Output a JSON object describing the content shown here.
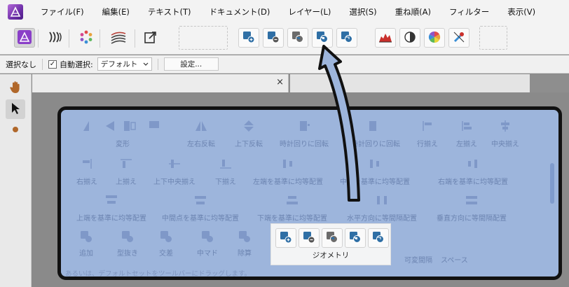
{
  "menu": [
    "ファイル(F)",
    "編集(E)",
    "テキスト(T)",
    "ドキュメント(D)",
    "レイヤー(L)",
    "選択(S)",
    "重ね順(A)",
    "フィルター",
    "表示(V)"
  ],
  "toolbar": {
    "personas": [
      {
        "icon": "designer-persona-icon"
      },
      {
        "icon": "pixel-persona-icon"
      },
      {
        "icon": "photo-persona-icon"
      },
      {
        "icon": "vector-brush-icon"
      },
      {
        "icon": "export-persona-icon"
      }
    ],
    "geometry": [
      {
        "icon": "geometry-add-icon"
      },
      {
        "icon": "geometry-subtract-icon"
      },
      {
        "icon": "geometry-intersect-icon"
      },
      {
        "icon": "geometry-xor-icon"
      },
      {
        "icon": "geometry-divide-icon"
      }
    ],
    "adjust": [
      {
        "icon": "levels-icon"
      },
      {
        "icon": "contrast-icon"
      },
      {
        "icon": "color-wheel-icon"
      },
      {
        "icon": "color-picker-icon"
      }
    ]
  },
  "context": {
    "selection": "選択なし",
    "auto_select_label": "自動選択:",
    "auto_select_checked": true,
    "auto_select_value": "デフォルト",
    "settings_button": "設定..."
  },
  "document_tab": {
    "close_glyph": "×"
  },
  "customize": {
    "row1": [
      "変形",
      "左右反転",
      "上下反転",
      "時計回りに回転",
      "反時計回りに回転",
      "行揃え",
      "左揃え",
      "中央揃え"
    ],
    "row2": [
      "右揃え",
      "上揃え",
      "上下中央揃え",
      "下揃え",
      "左端を基準に均等配置",
      "中心を基準に均等配置",
      "右端を基準に均等配置"
    ],
    "row3": [
      "上端を基準に均等配置",
      "中間点を基準に均等配置",
      "下端を基準に均等配置",
      "水平方向に等間隔配置",
      "垂直方向に等間隔配置"
    ],
    "row4": [
      "追加",
      "型抜き",
      "交差",
      "中マド",
      "除算"
    ],
    "row4_right": [
      "可変間隔",
      "スペース"
    ],
    "geometry_group_label": "ジオメトリ",
    "hint": "あるいは、デフォルトセットをツールバーにドラッグします。"
  },
  "colors": {
    "accent_blue": "#2f6fa5",
    "overlay_blue": "#9db5dc",
    "arrow_fill": "#9db5dc",
    "outline": "#111111"
  }
}
